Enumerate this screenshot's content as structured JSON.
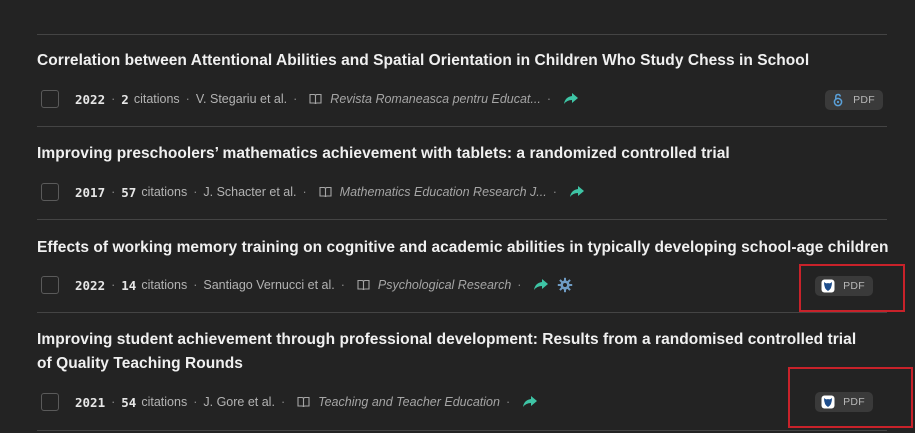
{
  "papers": [
    {
      "title": "Correlation between Attentional Abilities and Spatial Orientation in Children Who Study Chess in School",
      "year": "2022",
      "citations": "2",
      "citations_label": "citations",
      "authors": "V. Stegariu et al.",
      "journal": "Revista Romaneasca pentru Educat...",
      "pdf_label": "PDF",
      "pdf_icon": "open-access-icon"
    },
    {
      "title": "Improving preschoolers’ mathematics achievement with tablets: a randomized controlled trial",
      "year": "2017",
      "citations": "57",
      "citations_label": "citations",
      "authors": "J. Schacter et al.",
      "journal": "Mathematics Education Research J..."
    },
    {
      "title": "Effects of working memory training on cognitive and academic abilities in typically developing school-age children",
      "year": "2022",
      "citations": "14",
      "citations_label": "citations",
      "authors": "Santiago Vernucci et al.",
      "journal": "Psychological Research",
      "pdf_label": "PDF",
      "pdf_icon": "publisher-icon"
    },
    {
      "title": "Improving student achievement through professional development: Results from a randomised controlled trial of Quality Teaching Rounds",
      "year": "2021",
      "citations": "54",
      "citations_label": "citations",
      "authors": "J. Gore et al.",
      "journal": "Teaching and Teacher Education",
      "pdf_label": "PDF",
      "pdf_icon": "publisher-icon"
    }
  ],
  "colors": {
    "background": "#232323",
    "accent_teal": "#3ec4a5",
    "highlight_red": "#c8222a"
  }
}
